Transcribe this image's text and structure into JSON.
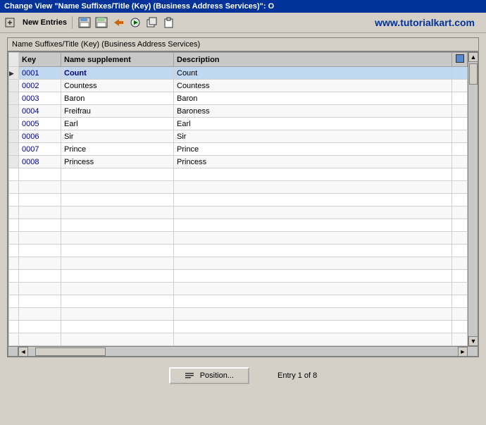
{
  "titleBar": {
    "text": "Change View \"Name Suffixes/Title (Key) (Business Address Services)\": O"
  },
  "toolbar": {
    "newEntriesLabel": "New Entries",
    "icons": [
      {
        "name": "new-entries-icon",
        "symbol": "✎"
      },
      {
        "name": "save-icon",
        "symbol": "💾"
      },
      {
        "name": "copy-icon",
        "symbol": "📋"
      },
      {
        "name": "undo-icon",
        "symbol": "↩"
      },
      {
        "name": "execute-icon",
        "symbol": "▶"
      },
      {
        "name": "clipboard-icon",
        "symbol": "📄"
      },
      {
        "name": "info-icon",
        "symbol": "ℹ"
      }
    ],
    "watermark": "www.tutorialkart.com"
  },
  "panel": {
    "title": "Name Suffixes/Title (Key) (Business Address Services)"
  },
  "table": {
    "columns": [
      {
        "id": "row-selector",
        "label": ""
      },
      {
        "id": "key",
        "label": "Key"
      },
      {
        "id": "name-supplement",
        "label": "Name supplement"
      },
      {
        "id": "description",
        "label": "Description"
      },
      {
        "id": "icon-col",
        "label": ""
      }
    ],
    "rows": [
      {
        "key": "0001",
        "supplement": "Count",
        "description": "Count",
        "selected": true
      },
      {
        "key": "0002",
        "supplement": "Countess",
        "description": "Countess",
        "selected": false
      },
      {
        "key": "0003",
        "supplement": "Baron",
        "description": "Baron",
        "selected": false
      },
      {
        "key": "0004",
        "supplement": "Freifrau",
        "description": "Baroness",
        "selected": false
      },
      {
        "key": "0005",
        "supplement": "Earl",
        "description": "Earl",
        "selected": false
      },
      {
        "key": "0006",
        "supplement": "Sir",
        "description": "Sir",
        "selected": false
      },
      {
        "key": "0007",
        "supplement": "Prince",
        "description": "Prince",
        "selected": false
      },
      {
        "key": "0008",
        "supplement": "Princess",
        "description": "Princess",
        "selected": false
      }
    ],
    "emptyRows": 14
  },
  "bottomBar": {
    "positionButtonLabel": "Position...",
    "entryInfo": "Entry 1 of 8"
  }
}
